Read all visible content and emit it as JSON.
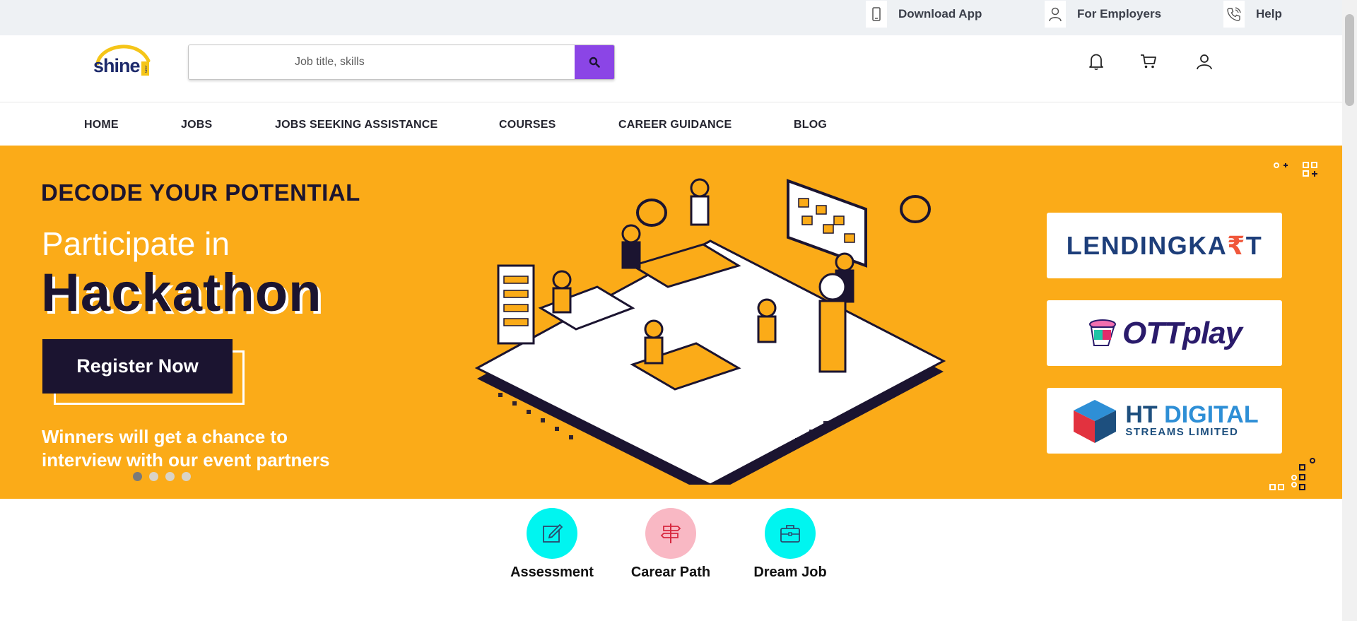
{
  "topbar": {
    "download_app": "Download App",
    "for_employers": "For Employers",
    "help": "Help"
  },
  "header": {
    "logo_text": "shine",
    "logo_suffix": ".com",
    "search_placeholder": "Job title, skills",
    "icons": [
      "bell-icon",
      "cart-icon",
      "user-icon"
    ]
  },
  "nav": {
    "items": [
      "HOME",
      "JOBS",
      "JOBS SEEKING ASSISTANCE",
      "COURSES",
      "CAREER GUIDANCE",
      "BLOG"
    ]
  },
  "banner": {
    "headline": "DECODE YOUR POTENTIAL",
    "subheadline": "Participate in",
    "title": "Hackathon",
    "cta": "Register Now",
    "winners_line1": "Winners will get a chance to",
    "winners_line2": "interview with our event partners",
    "slide_count": 4,
    "active_slide": 1,
    "partners": {
      "lendingkart_a": "LENDINGKA",
      "lendingkart_rupee": "₹",
      "lendingkart_b": "T",
      "ottplay": "OTTplay",
      "ht_a": "HT",
      "ht_b": "DIGITAL",
      "ht_sub": "STREAMS LIMITED"
    },
    "colors": {
      "background": "#fbab18",
      "dark": "#1b1430"
    }
  },
  "features": [
    {
      "label": "Assessment",
      "color": "#00f5f0",
      "icon": "edit-icon"
    },
    {
      "label": "Carear Path",
      "color": "#f9b8c4",
      "icon": "signpost-icon"
    },
    {
      "label": "Dream Job",
      "color": "#00f5f0",
      "icon": "briefcase-icon"
    }
  ],
  "colors": {
    "search_button": "#8b45e6",
    "topbar": "#eef1f4"
  }
}
